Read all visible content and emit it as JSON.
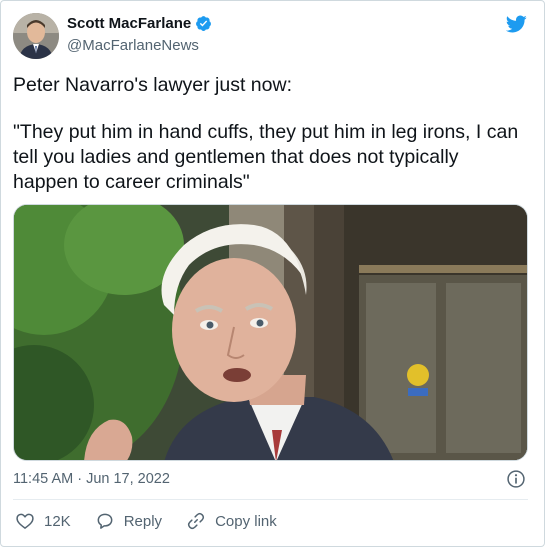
{
  "author": {
    "name": "Scott MacFarlane",
    "handle": "@MacFarlaneNews",
    "verified": true
  },
  "tweet": {
    "line1": "Peter Navarro's lawyer just now:",
    "line2": "\"They put him in hand cuffs, they put him in leg irons, I can tell you ladies and gentlemen that does not typically happen to career criminals\""
  },
  "timestamp": "11:45 AM · Jun 17, 2022",
  "actions": {
    "like_count": "12K",
    "reply_label": "Reply",
    "copy_label": "Copy link"
  },
  "icons": {
    "verified": "verified-badge-icon",
    "brand": "twitter-bird-icon",
    "info": "info-icon",
    "like": "heart-icon",
    "reply": "reply-bubble-icon",
    "copy": "link-icon"
  },
  "colors": {
    "brand": "#1d9bf0",
    "text": "#0f1419",
    "secondary": "#536471"
  }
}
